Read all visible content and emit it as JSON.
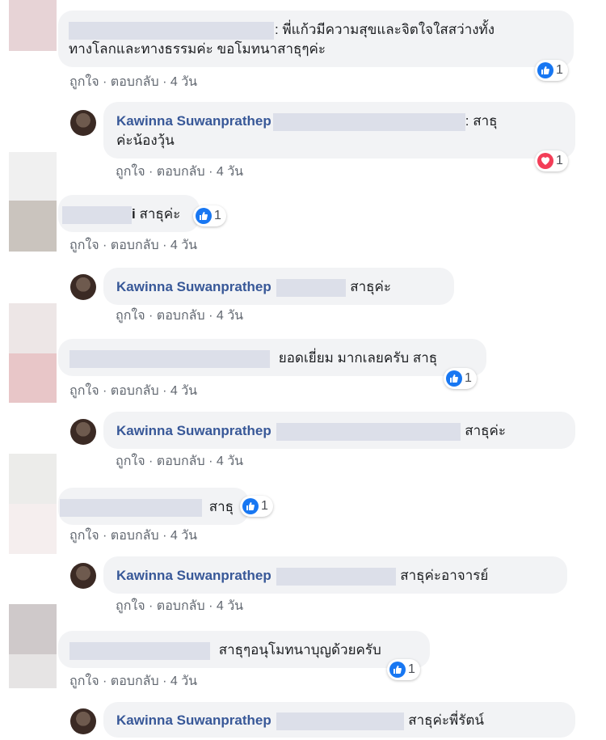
{
  "comments": [
    {
      "text_lines": [
        "พี่แก้วมีความสุขและจิตใจใสสว่างทั้ง",
        "ทางโลกและทางธรรมค่ะ ขอโมทนาสาธุๆค่ะ"
      ],
      "meta": {
        "like": "ถูกใจ",
        "reply": "ตอบกลับ",
        "time": "4 วัน"
      },
      "reaction": {
        "type": "like",
        "count": "1"
      }
    },
    {
      "name": "Kawinna Suwanprathep",
      "text_lines": [
        "สาธุ",
        "ค่ะน้องวุ้น"
      ],
      "meta": {
        "like": "ถูกใจ",
        "reply": "ตอบกลับ",
        "time": "4 วัน"
      },
      "reaction": {
        "type": "love",
        "count": "1"
      }
    },
    {
      "text": "สาธุค่ะ",
      "prefix": "i",
      "meta": {
        "like": "ถูกใจ",
        "reply": "ตอบกลับ",
        "time": "4 วัน"
      },
      "reaction": {
        "type": "like",
        "count": "1"
      }
    },
    {
      "name": "Kawinna Suwanprathep",
      "text": "สาธุค่ะ",
      "meta": {
        "like": "ถูกใจ",
        "reply": "ตอบกลับ",
        "time": "4 วัน"
      }
    },
    {
      "text": "ยอดเยี่ยม มากเลยครับ สาธุ",
      "meta": {
        "like": "ถูกใจ",
        "reply": "ตอบกลับ",
        "time": "4 วัน"
      },
      "reaction": {
        "type": "like",
        "count": "1"
      }
    },
    {
      "name": "Kawinna Suwanprathep",
      "text": "สาธุค่ะ",
      "meta": {
        "like": "ถูกใจ",
        "reply": "ตอบกลับ",
        "time": "4 วัน"
      }
    },
    {
      "text": "สาธุ",
      "meta": {
        "like": "ถูกใจ",
        "reply": "ตอบกลับ",
        "time": "4 วัน"
      },
      "reaction": {
        "type": "like",
        "count": "1"
      }
    },
    {
      "name": "Kawinna Suwanprathep",
      "text": "สาธุค่ะอาจารย์",
      "meta": {
        "like": "ถูกใจ",
        "reply": "ตอบกลับ",
        "time": "4 วัน"
      }
    },
    {
      "text": "สาธุๆอนุโมทนาบุญด้วยครับ",
      "meta": {
        "like": "ถูกใจ",
        "reply": "ตอบกลับ",
        "time": "4 วัน"
      },
      "reaction": {
        "type": "like",
        "count": "1"
      }
    },
    {
      "name": "Kawinna Suwanprathep",
      "text": "สาธุค่ะพี่รัตน์"
    }
  ],
  "separator": "·",
  "colors": {
    "link": "#385898",
    "like": "#1877f2",
    "love": "#f33e58",
    "bubble": "#f2f3f5"
  }
}
